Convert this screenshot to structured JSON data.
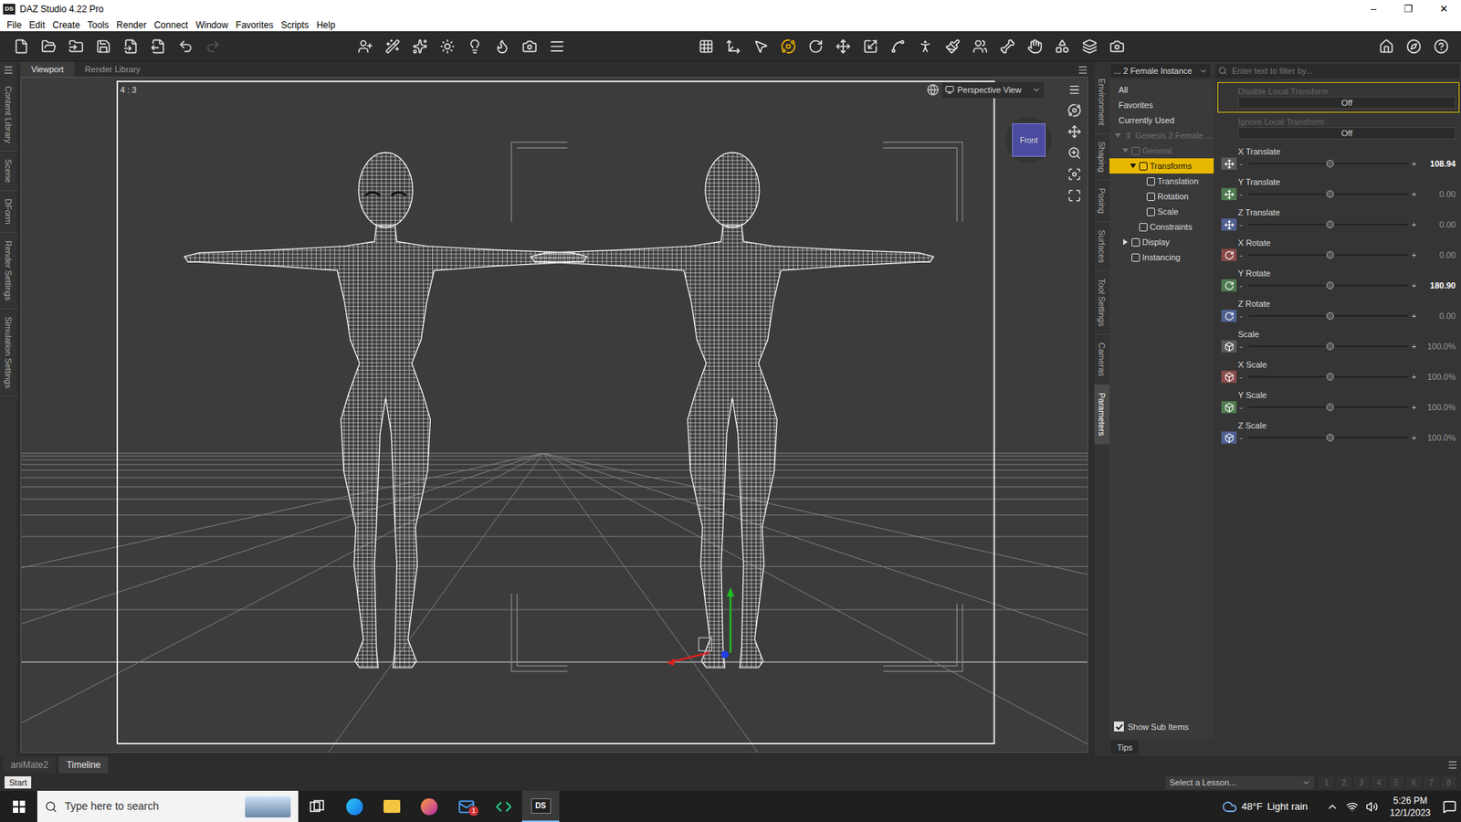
{
  "window": {
    "title": "DAZ Studio 4.22 Pro",
    "icon": "DS",
    "controls": [
      "–",
      "❐",
      "✕"
    ]
  },
  "menu": [
    "File",
    "Edit",
    "Create",
    "Tools",
    "Render",
    "Connect",
    "Window",
    "Favorites",
    "Scripts",
    "Help"
  ],
  "toolbar": {
    "file_tools": [
      {
        "disabled": false
      },
      {
        "disabled": false
      },
      {
        "disabled": false
      },
      {
        "disabled": false
      },
      {
        "disabled": false
      },
      {
        "disabled": false
      },
      {
        "disabled": false
      },
      {
        "disabled": true
      }
    ],
    "tools": [
      {
        "selected": false
      },
      {
        "selected": false
      },
      {
        "selected": false
      },
      {
        "selected": true
      },
      {
        "selected": false
      },
      {
        "selected": false
      },
      {
        "selected": false
      },
      {
        "selected": false
      },
      {
        "selected": false
      },
      {
        "selected": false
      },
      {
        "selected": false
      },
      {
        "selected": false
      },
      {
        "selected": false
      },
      {
        "selected": false
      },
      {
        "selected": false
      },
      {
        "selected": false
      }
    ]
  },
  "left_tabs": [
    {
      "label": "Content Library",
      "selected": false
    },
    {
      "label": "Scene",
      "selected": false
    },
    {
      "label": "DForm",
      "selected": false
    },
    {
      "label": "Render Settings",
      "selected": false
    },
    {
      "label": "Simulation Settings",
      "selected": false
    }
  ],
  "viewport": {
    "tabs": [
      {
        "label": "Viewport",
        "selected": true
      },
      {
        "label": "Render Library",
        "selected": false
      }
    ],
    "aspect": "4 : 3",
    "view": "Perspective View",
    "cube": "Front",
    "figures": [
      {
        "eyes": true,
        "selected": false
      },
      {
        "eyes": false,
        "selected": true
      }
    ]
  },
  "right_tabs": [
    {
      "label": "Environment",
      "selected": false
    },
    {
      "label": "Shaping",
      "selected": false
    },
    {
      "label": "Posing",
      "selected": false
    },
    {
      "label": "Surfaces",
      "selected": false
    },
    {
      "label": "Tool Settings",
      "selected": false
    },
    {
      "label": "Cameras",
      "selected": false
    },
    {
      "label": "Parameters",
      "selected": true
    }
  ],
  "parameters": {
    "node": "... 2 Female Instance",
    "filter_placeholder": "Enter text to filter by...",
    "tree": [
      {
        "label": "All",
        "depth": 0,
        "kind": "filter",
        "expandable": false,
        "expanded": false,
        "selected": false,
        "disabled": false
      },
      {
        "label": "Favorites",
        "depth": 0,
        "kind": "filter",
        "expandable": false,
        "expanded": false,
        "selected": false,
        "disabled": false
      },
      {
        "label": "Currently Used",
        "depth": 0,
        "kind": "filter",
        "expandable": false,
        "expanded": false,
        "selected": false,
        "disabled": false
      },
      {
        "label": "Genesis 2 Female ...",
        "depth": 0,
        "kind": "figure",
        "expandable": true,
        "expanded": true,
        "selected": false,
        "disabled": true
      },
      {
        "label": "General",
        "depth": 1,
        "kind": "group",
        "expandable": true,
        "expanded": true,
        "selected": false,
        "disabled": true
      },
      {
        "label": "Transforms",
        "depth": 2,
        "kind": "group",
        "expandable": true,
        "expanded": true,
        "selected": true,
        "disabled": false
      },
      {
        "label": "Translation",
        "depth": 3,
        "kind": "group",
        "expandable": false,
        "expanded": false,
        "selected": false,
        "disabled": false
      },
      {
        "label": "Rotation",
        "depth": 3,
        "kind": "group",
        "expandable": false,
        "expanded": false,
        "selected": false,
        "disabled": false
      },
      {
        "label": "Scale",
        "depth": 3,
        "kind": "group",
        "expandable": false,
        "expanded": false,
        "selected": false,
        "disabled": false
      },
      {
        "label": "Constraints",
        "depth": 2,
        "kind": "group",
        "expandable": false,
        "expanded": false,
        "selected": false,
        "disabled": false
      },
      {
        "label": "Display",
        "depth": 1,
        "kind": "group",
        "expandable": true,
        "expanded": false,
        "selected": false,
        "disabled": false
      },
      {
        "label": "Instancing",
        "depth": 1,
        "kind": "group",
        "expandable": false,
        "expanded": false,
        "selected": false,
        "disabled": false
      }
    ],
    "show_sub_items": {
      "label": "Show Sub Items",
      "checked": true
    },
    "tips": "Tips",
    "minus": "-",
    "plus": "+",
    "rows": [
      {
        "label": "Disable Local Transform",
        "kind": "toggle",
        "value": "Off",
        "disabled": true,
        "focused": true
      },
      {
        "label": "Ignore Local Transform",
        "kind": "toggle",
        "value": "Off",
        "disabled": true,
        "focused": false
      },
      {
        "label": "X Translate",
        "kind": "translate",
        "value": "108.94",
        "level": 0.51,
        "modified": true,
        "color": "#5a5a5a"
      },
      {
        "label": "Y Translate",
        "kind": "translate",
        "value": "0.00",
        "level": 0.51,
        "modified": false,
        "color": "#4f7a4f"
      },
      {
        "label": "Z Translate",
        "kind": "translate",
        "value": "0.00",
        "level": 0.51,
        "modified": false,
        "color": "#4f5f8f"
      },
      {
        "label": "X Rotate",
        "kind": "rotate",
        "value": "0.00",
        "level": 0.51,
        "modified": false,
        "color": "#8a4a4a"
      },
      {
        "label": "Y Rotate",
        "kind": "rotate",
        "value": "180.90",
        "level": 0.51,
        "modified": true,
        "color": "#4f7a4f"
      },
      {
        "label": "Z Rotate",
        "kind": "rotate",
        "value": "0.00",
        "level": 0.51,
        "modified": false,
        "color": "#4f5f8f"
      },
      {
        "label": "Scale",
        "kind": "scale",
        "value": "100.0%",
        "level": 0.51,
        "modified": false,
        "color": "#5a5a5a"
      },
      {
        "label": "X Scale",
        "kind": "scale",
        "value": "100.0%",
        "level": 0.51,
        "modified": false,
        "color": "#8a4a4a"
      },
      {
        "label": "Y Scale",
        "kind": "scale",
        "value": "100.0%",
        "level": 0.51,
        "modified": false,
        "color": "#4f7a4f"
      },
      {
        "label": "Z Scale",
        "kind": "scale",
        "value": "100.0%",
        "level": 0.51,
        "modified": false,
        "color": "#4f5f8f"
      }
    ]
  },
  "bottom_tabs": [
    {
      "label": "aniMate2",
      "selected": false
    },
    {
      "label": "Timeline",
      "selected": true
    }
  ],
  "status": {
    "start": "Start",
    "lesson": "Select a Lesson...",
    "pages": [
      "1",
      "2",
      "3",
      "4",
      "5",
      "6",
      "7",
      "8"
    ]
  },
  "taskbar": {
    "search": "Type here to search",
    "temperature": "48°F",
    "condition": "Light rain",
    "time": "5:26 PM",
    "date": "12/1/2023",
    "apps": [
      {
        "selected": false,
        "badge": ""
      },
      {
        "selected": false,
        "badge": ""
      },
      {
        "selected": false,
        "badge": ""
      },
      {
        "selected": false,
        "badge": ""
      },
      {
        "selected": false,
        "badge": "1"
      },
      {
        "selected": false,
        "badge": ""
      },
      {
        "selected": true,
        "badge": "",
        "label": "DS"
      }
    ]
  }
}
